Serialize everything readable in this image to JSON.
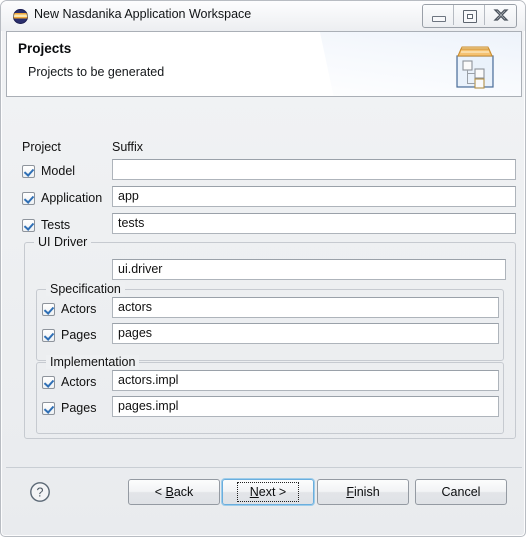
{
  "window": {
    "title": "New Nasdanika Application Workspace",
    "icon": "nasdanika-logo-icon",
    "controls": {
      "minimize": "minimize-icon",
      "restore": "restore-icon",
      "close": "close-icon"
    }
  },
  "banner": {
    "title": "Projects",
    "subtitle": "Projects to be generated",
    "icon": "projects-folder-icon"
  },
  "form": {
    "headers": {
      "project": "Project",
      "suffix": "Suffix"
    },
    "rows": [
      {
        "label": "Model",
        "checked": true,
        "value": ""
      },
      {
        "label": "Application",
        "checked": true,
        "value": "app"
      },
      {
        "label": "Tests",
        "checked": true,
        "value": "tests"
      }
    ],
    "ui_driver": {
      "title": "UI Driver",
      "value": "ui.driver",
      "specification": {
        "title": "Specification",
        "rows": [
          {
            "label": "Actors",
            "checked": true,
            "value": "actors"
          },
          {
            "label": "Pages",
            "checked": true,
            "value": "pages"
          }
        ]
      },
      "implementation": {
        "title": "Implementation",
        "rows": [
          {
            "label": "Actors",
            "checked": true,
            "value": "actors.impl"
          },
          {
            "label": "Pages",
            "checked": true,
            "value": "pages.impl"
          }
        ]
      }
    }
  },
  "buttons": {
    "help": "help-icon",
    "back": {
      "pre": "< ",
      "mnemonic": "B",
      "post": "ack",
      "focused": false
    },
    "next": {
      "pre": "",
      "mnemonic": "N",
      "post": "ext >",
      "focused": true
    },
    "finish": {
      "pre": "",
      "mnemonic": "F",
      "post": "inish",
      "focused": false
    },
    "cancel": {
      "pre": "",
      "mnemonic": "",
      "post": "Cancel",
      "focused": false
    }
  },
  "colors": {
    "accent": "#2f6fb5",
    "focus_ring": "#6aaede",
    "panel": "#eef0f2",
    "banner": "#ffffff"
  }
}
